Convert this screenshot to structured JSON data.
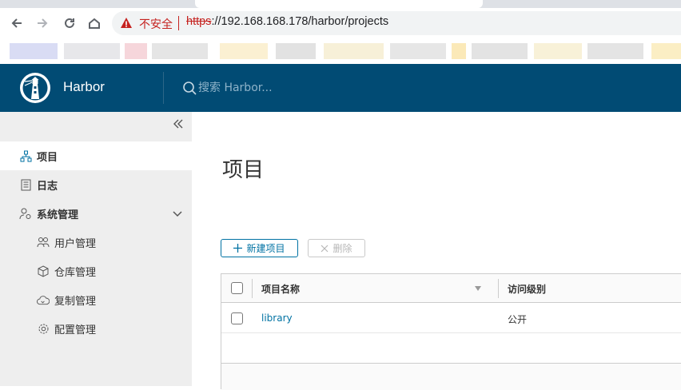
{
  "browser": {
    "security_label": "不安全",
    "url_scheme": "https",
    "url_rest": "://192.168.168.178/harbor/projects"
  },
  "header": {
    "brand": "Harbor",
    "search_placeholder": "搜索 Harbor..."
  },
  "sidebar": {
    "items": [
      {
        "label": "项目",
        "icon": "org-chart-icon",
        "active": true
      },
      {
        "label": "日志",
        "icon": "log-list-icon"
      },
      {
        "label": "系统管理",
        "icon": "admin-user-gear-icon",
        "expanded": true
      },
      {
        "label": "用户管理",
        "icon": "users-icon"
      },
      {
        "label": "仓库管理",
        "icon": "cube-icon"
      },
      {
        "label": "复制管理",
        "icon": "cloud-sync-icon"
      },
      {
        "label": "配置管理",
        "icon": "gear-icon"
      }
    ]
  },
  "main": {
    "title": "项目",
    "new_project_label": "新建项目",
    "delete_label": "删除",
    "columns": [
      "项目名称",
      "访问级别"
    ],
    "rows": [
      {
        "name": "library",
        "access": "公开"
      }
    ]
  },
  "colors": {
    "header_bg": "#014b74",
    "link": "#0072a3",
    "insecure": "#c5221f"
  }
}
